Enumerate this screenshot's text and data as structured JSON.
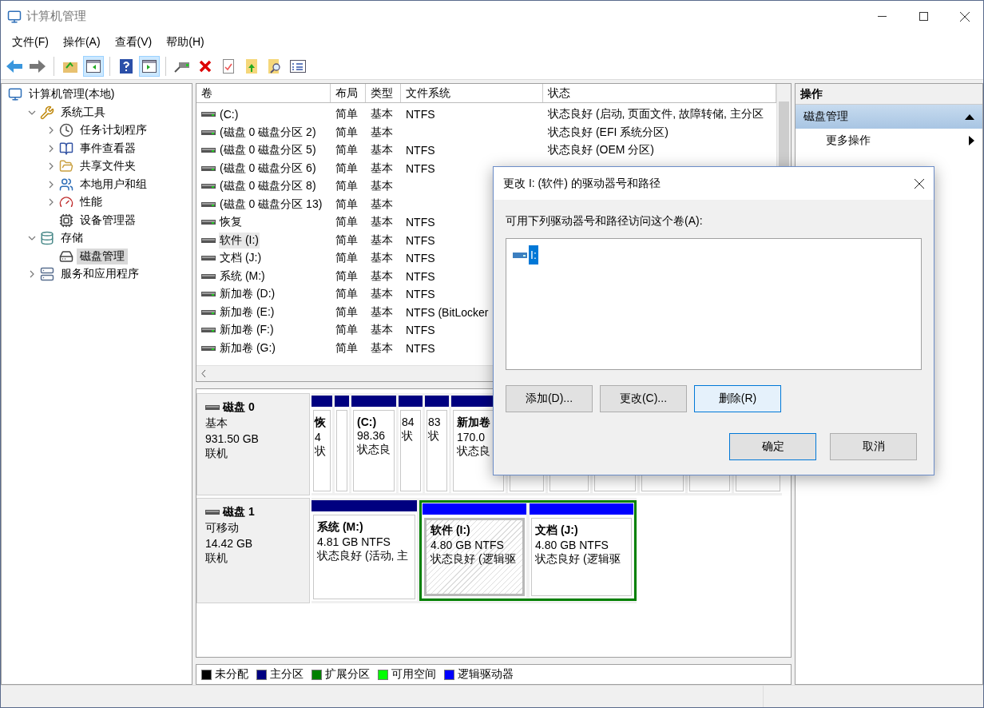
{
  "window": {
    "title": "计算机管理"
  },
  "menu": [
    "文件(F)",
    "操作(A)",
    "查看(V)",
    "帮助(H)"
  ],
  "toolbar": [
    {
      "kind": "back",
      "pressed": false
    },
    {
      "kind": "forward",
      "pressed": false
    },
    {
      "kind": "sep"
    },
    {
      "kind": "up",
      "pressed": false
    },
    {
      "kind": "tree",
      "pressed": true
    },
    {
      "kind": "sep"
    },
    {
      "kind": "help",
      "pressed": false
    },
    {
      "kind": "pane",
      "pressed": true
    },
    {
      "kind": "sep"
    },
    {
      "kind": "connect",
      "pressed": false
    },
    {
      "kind": "delete",
      "pressed": false
    },
    {
      "kind": "check",
      "pressed": false
    },
    {
      "kind": "import",
      "pressed": false
    },
    {
      "kind": "find",
      "pressed": false
    },
    {
      "kind": "list",
      "pressed": false
    }
  ],
  "tree": [
    {
      "label": "计算机管理(本地)",
      "selected": false,
      "children": [
        {
          "label": "系统工具",
          "expanded": true,
          "selected": false,
          "children": [
            {
              "label": "任务计划程序",
              "expanded": false,
              "selected": false
            },
            {
              "label": "事件查看器",
              "expanded": false,
              "selected": false
            },
            {
              "label": "共享文件夹",
              "expanded": false,
              "selected": false
            },
            {
              "label": "本地用户和组",
              "expanded": false,
              "selected": false
            },
            {
              "label": "性能",
              "expanded": false,
              "selected": false
            },
            {
              "label": "设备管理器",
              "selected": false
            }
          ]
        },
        {
          "label": "存储",
          "expanded": true,
          "selected": false,
          "children": [
            {
              "label": "磁盘管理",
              "selected": true
            }
          ]
        },
        {
          "label": "服务和应用程序",
          "expanded": false,
          "selected": false
        }
      ]
    }
  ],
  "table": {
    "columns": [
      "卷",
      "布局",
      "类型",
      "文件系统",
      "状态"
    ],
    "rows": [
      {
        "volume": " (C:)",
        "layout": "简单",
        "type": "基本",
        "fs": "NTFS",
        "status": "状态良好 (启动, 页面文件, 故障转储, 主分区",
        "removable": false,
        "selected": false
      },
      {
        "volume": "(磁盘 0 磁盘分区 2)",
        "layout": "简单",
        "type": "基本",
        "status": "状态良好 (EFI 系统分区)",
        "removable": false,
        "selected": false
      },
      {
        "volume": "(磁盘 0 磁盘分区 5)",
        "layout": "简单",
        "type": "基本",
        "fs": "NTFS",
        "status": "状态良好 (OEM 分区)",
        "removable": false,
        "selected": false
      },
      {
        "volume": "(磁盘 0 磁盘分区 6)",
        "layout": "简单",
        "type": "基本",
        "fs": "NTFS",
        "removable": false,
        "selected": false
      },
      {
        "volume": "(磁盘 0 磁盘分区 8)",
        "layout": "简单",
        "type": "基本",
        "removable": false,
        "selected": false
      },
      {
        "volume": "(磁盘 0 磁盘分区 13)",
        "layout": "简单",
        "type": "基本",
        "removable": false,
        "selected": false
      },
      {
        "volume": "恢复",
        "layout": "简单",
        "type": "基本",
        "fs": "NTFS",
        "removable": false,
        "selected": false
      },
      {
        "volume": "软件 (I:)",
        "layout": "简单",
        "type": "基本",
        "fs": "NTFS",
        "removable": true,
        "selected": true
      },
      {
        "volume": "文档 (J:)",
        "layout": "简单",
        "type": "基本",
        "fs": "NTFS",
        "removable": true,
        "selected": false
      },
      {
        "volume": "系统 (M:)",
        "layout": "简单",
        "type": "基本",
        "fs": "NTFS",
        "removable": true,
        "selected": false
      },
      {
        "volume": "新加卷 (D:)",
        "layout": "简单",
        "type": "基本",
        "fs": "NTFS",
        "removable": false,
        "selected": false
      },
      {
        "volume": "新加卷 (E:)",
        "layout": "简单",
        "type": "基本",
        "fs": "NTFS (BitLocker",
        "removable": false,
        "selected": false
      },
      {
        "volume": "新加卷 (F:)",
        "layout": "简单",
        "type": "基本",
        "fs": "NTFS",
        "removable": false,
        "selected": false
      },
      {
        "volume": "新加卷 (G:)",
        "layout": "简单",
        "type": "基本",
        "fs": "NTFS",
        "removable": false,
        "selected": false
      }
    ]
  },
  "disks": [
    {
      "name": "磁盘 0",
      "kind": "基本",
      "size": "931.50 GB",
      "state": "联机",
      "partitions": [
        {
          "kind": "primary",
          "name": "恢",
          "size": "4",
          "status": "状",
          "selected": false
        },
        {
          "kind": "primary",
          "selected": false
        },
        {
          "kind": "primary",
          "name": "(C:)",
          "size": "98.36",
          "status": "状态良",
          "selected": false
        },
        {
          "kind": "primary",
          "size": "84",
          "status": "状",
          "selected": false
        },
        {
          "kind": "primary",
          "size": "83",
          "status": "状",
          "selected": false
        },
        {
          "kind": "primary",
          "name": "新加卷",
          "size": "170.0",
          "status": "状态良",
          "selected": false
        },
        {
          "selected": false
        },
        {
          "selected": false
        },
        {
          "selected": false
        },
        {
          "selected": false
        },
        {
          "selected": false
        },
        {
          "selected": false
        }
      ]
    },
    {
      "name": "磁盘 1",
      "kind": "可移动",
      "size": "14.42 GB",
      "state": "联机",
      "partitions": [
        {
          "kind": "primary",
          "name": "系统  (M:)",
          "size": "4.81 GB NTFS",
          "status": "状态良好 (活动, 主",
          "selected": false
        },
        {
          "kind": "extended",
          "children": [
            {
              "kind": "logical",
              "name": "软件  (I:)",
              "size": "4.80 GB NTFS",
              "status": "状态良好 (逻辑驱",
              "selected": true
            },
            {
              "kind": "logical",
              "name": "文档  (J:)",
              "size": "4.80 GB NTFS",
              "status": "状态良好 (逻辑驱",
              "selected": false
            }
          ]
        }
      ]
    }
  ],
  "legend": [
    {
      "label": "未分配",
      "color": "#000000"
    },
    {
      "label": "主分区",
      "color": "#000080"
    },
    {
      "label": "扩展分区",
      "color": "#008000"
    },
    {
      "label": "可用空间",
      "color": "#00ff00"
    },
    {
      "label": "逻辑驱动器",
      "color": "#0000ff"
    }
  ],
  "actions": {
    "title": "操作",
    "section": {
      "label": "磁盘管理",
      "expanded": true
    },
    "items": [
      "更多操作"
    ]
  },
  "dialog": {
    "title": "更改 I: (软件) 的驱动器号和路径",
    "prompt": "可用下列驱动器号和路径访问这个卷(A):",
    "list": [
      {
        "label": "I:",
        "selected": true
      }
    ],
    "buttons": [
      {
        "label": "添加(D)...",
        "highlighted": false
      },
      {
        "label": "更改(C)...",
        "highlighted": false
      },
      {
        "label": "删除(R)",
        "highlighted": true
      }
    ],
    "footer": [
      {
        "label": "确定",
        "default": true
      },
      {
        "label": "取消",
        "default": false
      }
    ]
  }
}
